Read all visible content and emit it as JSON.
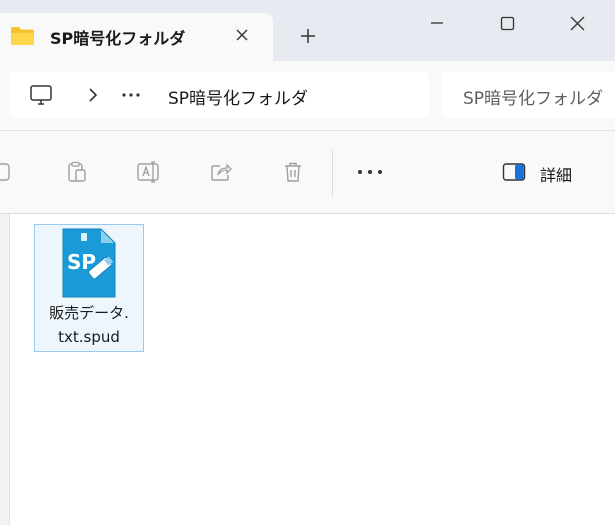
{
  "tab": {
    "title": "SP暗号化フォルダ",
    "folder_icon": "folder-icon"
  },
  "window": {
    "new_tab_glyph": "+",
    "minimize_icon": "minimize-icon",
    "maximize_icon": "maximize-icon",
    "close_icon": "close-icon"
  },
  "address": {
    "breadcrumb": "SP暗号化フォルダ",
    "search_placeholder": "SP暗号化フォルダ"
  },
  "commandbar": {
    "more_glyph": "•••",
    "details_label": "詳細"
  },
  "files": [
    {
      "name_line1": "販売データ.",
      "name_line2": "txt.spud",
      "icon": "spud-file-icon"
    }
  ],
  "colors": {
    "titlebar": "#e7eaf0",
    "selection_bg": "#eef6fd",
    "selection_border": "#99c9ef",
    "icon_blue": "#1a9bd7"
  }
}
